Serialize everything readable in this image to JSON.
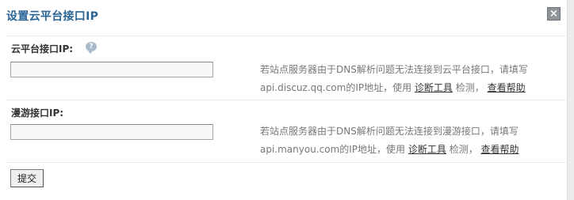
{
  "dialog": {
    "title": "设置云平台接口IP",
    "close_label": "×"
  },
  "cloud": {
    "label": "云平台接口IP:",
    "help_glyph": "?",
    "input_value": "",
    "hint_line1": "若站点服务器由于DNS解析问题无法连接到云平台接口，请填写",
    "hint_line2_prefix": "api.discuz.qq.com的IP地址，使用 ",
    "diag_link": "诊断工具",
    "hint_mid": " 检测， ",
    "help_link": "查看帮助"
  },
  "manyou": {
    "label": "漫游接口IP:",
    "input_value": "",
    "hint_line1": "若站点服务器由于DNS解析问题无法连接到漫游接口，请填写",
    "hint_line2_prefix": "api.manyou.com的IP地址，使用 ",
    "diag_link": "诊断工具",
    "hint_mid": " 检测， ",
    "help_link": "查看帮助"
  },
  "submit_label": "提交",
  "colors": {
    "title": "#2a6496",
    "close_bg": "#8d9399",
    "hint_text": "#777777"
  }
}
